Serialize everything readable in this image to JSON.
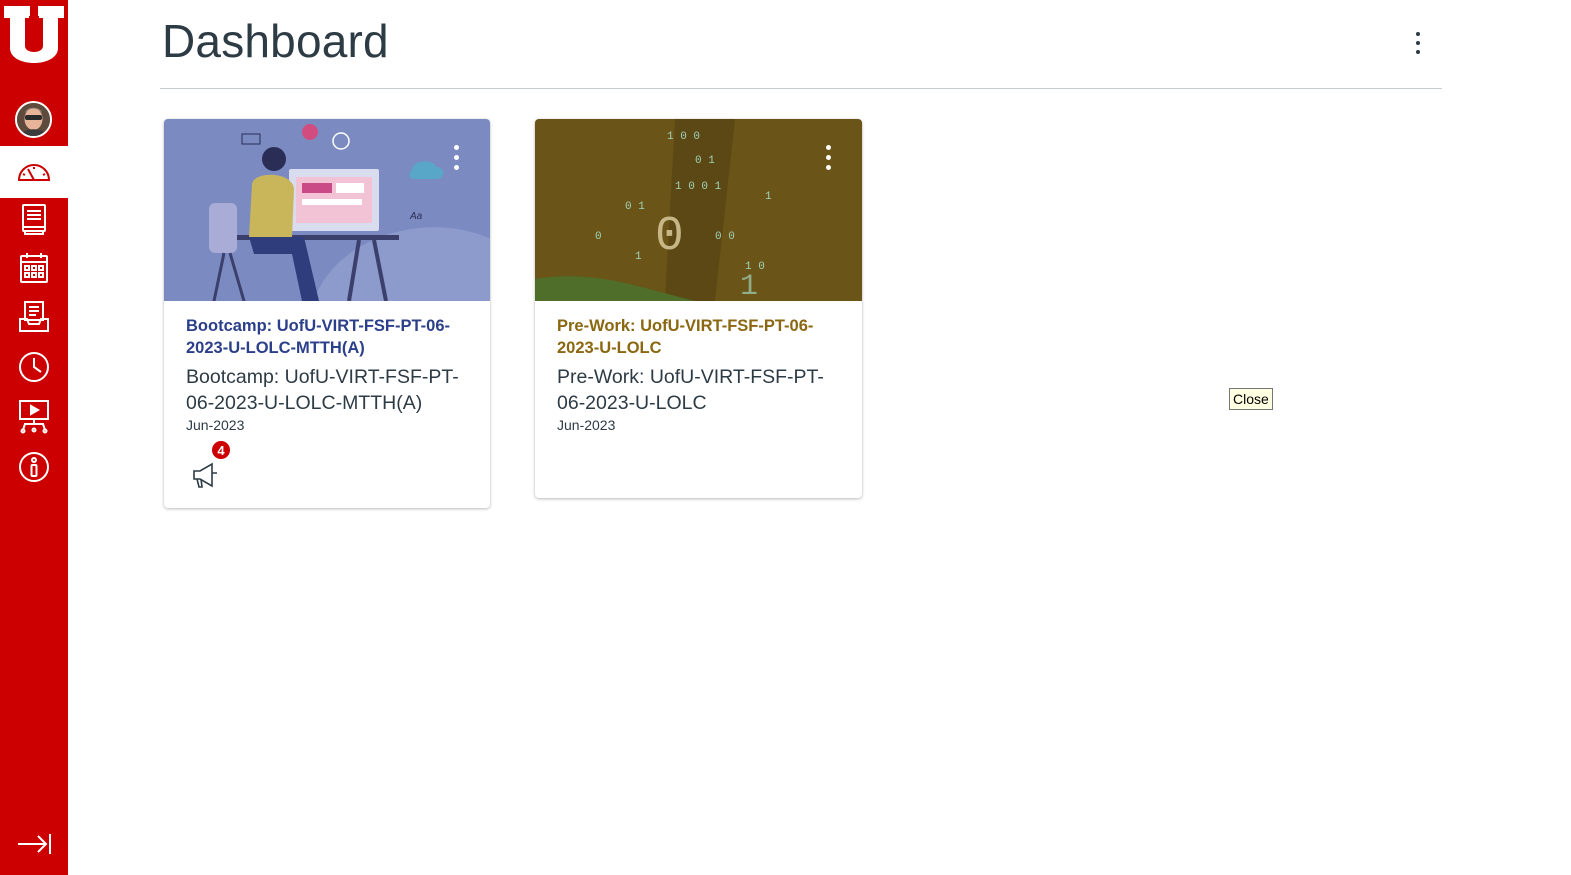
{
  "header": {
    "title": "Dashboard"
  },
  "nav": {
    "items": [
      "Account",
      "Dashboard",
      "Courses",
      "Calendar",
      "Inbox",
      "History",
      "Studio",
      "Help"
    ],
    "collapse_label": "Collapse"
  },
  "colors": {
    "brand_red": "#cc0000",
    "card1_title": "#2c3f8a",
    "card2_title": "#8a6710",
    "card1_hero": "#7b8bc2",
    "card2_hero": "#6b5418"
  },
  "cards": [
    {
      "title": "Bootcamp: UofU-VIRT-FSF-PT-06-2023-U-LOLC-MTTH(A)",
      "subtitle": "Bootcamp: UofU-VIRT-FSF-PT-06-2023-U-LOLC-MTTH(A)",
      "term": "Jun-2023",
      "announcements_count": "4",
      "icon": "megaphone-icon"
    },
    {
      "title": "Pre-Work: UofU-VIRT-FSF-PT-06-2023-U-LOLC",
      "subtitle": "Pre-Work: UofU-VIRT-FSF-PT-06-2023-U-LOLC",
      "term": "Jun-2023"
    }
  ],
  "tooltip": {
    "close": "Close"
  }
}
